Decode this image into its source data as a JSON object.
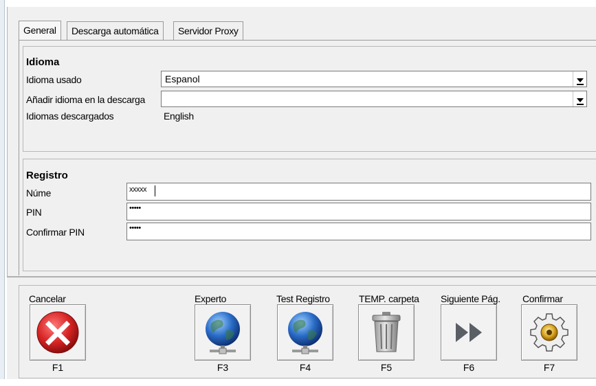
{
  "tabs": [
    {
      "label": "General",
      "active": true
    },
    {
      "label": "Descarga automática",
      "active": false
    },
    {
      "label": "Servidor Proxy",
      "active": false
    }
  ],
  "idioma": {
    "title": "Idioma",
    "used_label": "Idioma usado",
    "used_value": "Espanol",
    "add_label": "Añadir idioma en la descarga",
    "add_value": "",
    "downloaded_label": "Idiomas descargados",
    "downloaded_value": "English"
  },
  "registro": {
    "title": "Registro",
    "name_label": "Núme",
    "name_value": "xxxxx",
    "pin_label": "PIN",
    "pin_value": "•••••",
    "confirm_label": "Confirmar PIN",
    "confirm_value": "•••••"
  },
  "buttons": [
    {
      "label": "Cancelar",
      "key": "F1",
      "icon": "cancel-icon"
    },
    {
      "label": "Experto",
      "key": "F3",
      "icon": "globe-network-icon"
    },
    {
      "label": "Test Registro",
      "key": "F4",
      "icon": "globe-network-icon"
    },
    {
      "label": "TEMP. carpeta",
      "key": "F5",
      "icon": "trash-icon"
    },
    {
      "label": "Siguiente Pág.",
      "key": "F6",
      "icon": "fast-forward-icon"
    },
    {
      "label": "Confirmar",
      "key": "F7",
      "icon": "gear-icon"
    }
  ],
  "colors": {
    "window_bg": "#f0f0f0",
    "cancel_red": "#d32020",
    "globe_blue": "#1f5fbf"
  }
}
